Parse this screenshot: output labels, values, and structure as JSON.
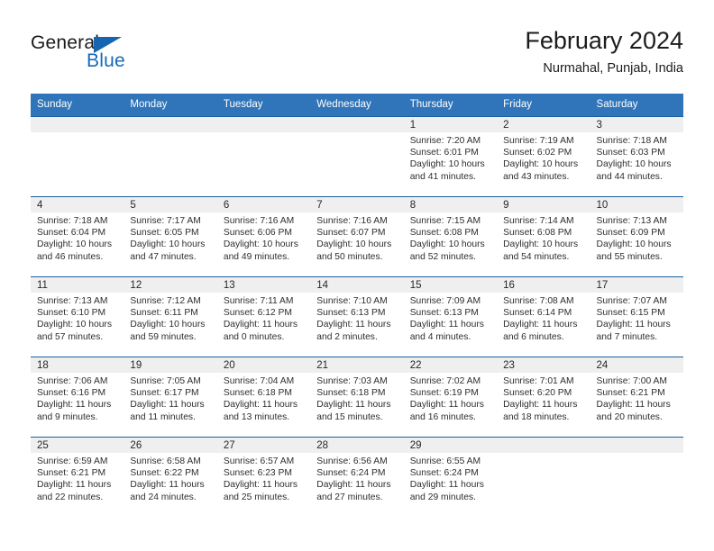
{
  "logo": {
    "word_one": "General",
    "word_two": "Blue",
    "accent_color": "#1668ba",
    "triangle_icon": "triangle-icon"
  },
  "header": {
    "title": "February 2024",
    "location": "Nurmahal, Punjab, India"
  },
  "calendar": {
    "header_bg": "#3075b9",
    "row_border": "#1b5ea0",
    "daynum_band_bg": "#efefef",
    "weekdays": [
      "Sunday",
      "Monday",
      "Tuesday",
      "Wednesday",
      "Thursday",
      "Friday",
      "Saturday"
    ],
    "weeks": [
      [
        {
          "day": "",
          "sunrise": "",
          "sunset": "",
          "daylight_line1": "",
          "daylight_line2": "",
          "empty": true
        },
        {
          "day": "",
          "sunrise": "",
          "sunset": "",
          "daylight_line1": "",
          "daylight_line2": "",
          "empty": true
        },
        {
          "day": "",
          "sunrise": "",
          "sunset": "",
          "daylight_line1": "",
          "daylight_line2": "",
          "empty": true
        },
        {
          "day": "",
          "sunrise": "",
          "sunset": "",
          "daylight_line1": "",
          "daylight_line2": "",
          "empty": true
        },
        {
          "day": "1",
          "sunrise": "Sunrise: 7:20 AM",
          "sunset": "Sunset: 6:01 PM",
          "daylight_line1": "Daylight: 10 hours",
          "daylight_line2": "and 41 minutes.",
          "empty": false
        },
        {
          "day": "2",
          "sunrise": "Sunrise: 7:19 AM",
          "sunset": "Sunset: 6:02 PM",
          "daylight_line1": "Daylight: 10 hours",
          "daylight_line2": "and 43 minutes.",
          "empty": false
        },
        {
          "day": "3",
          "sunrise": "Sunrise: 7:18 AM",
          "sunset": "Sunset: 6:03 PM",
          "daylight_line1": "Daylight: 10 hours",
          "daylight_line2": "and 44 minutes.",
          "empty": false
        }
      ],
      [
        {
          "day": "4",
          "sunrise": "Sunrise: 7:18 AM",
          "sunset": "Sunset: 6:04 PM",
          "daylight_line1": "Daylight: 10 hours",
          "daylight_line2": "and 46 minutes.",
          "empty": false
        },
        {
          "day": "5",
          "sunrise": "Sunrise: 7:17 AM",
          "sunset": "Sunset: 6:05 PM",
          "daylight_line1": "Daylight: 10 hours",
          "daylight_line2": "and 47 minutes.",
          "empty": false
        },
        {
          "day": "6",
          "sunrise": "Sunrise: 7:16 AM",
          "sunset": "Sunset: 6:06 PM",
          "daylight_line1": "Daylight: 10 hours",
          "daylight_line2": "and 49 minutes.",
          "empty": false
        },
        {
          "day": "7",
          "sunrise": "Sunrise: 7:16 AM",
          "sunset": "Sunset: 6:07 PM",
          "daylight_line1": "Daylight: 10 hours",
          "daylight_line2": "and 50 minutes.",
          "empty": false
        },
        {
          "day": "8",
          "sunrise": "Sunrise: 7:15 AM",
          "sunset": "Sunset: 6:08 PM",
          "daylight_line1": "Daylight: 10 hours",
          "daylight_line2": "and 52 minutes.",
          "empty": false
        },
        {
          "day": "9",
          "sunrise": "Sunrise: 7:14 AM",
          "sunset": "Sunset: 6:08 PM",
          "daylight_line1": "Daylight: 10 hours",
          "daylight_line2": "and 54 minutes.",
          "empty": false
        },
        {
          "day": "10",
          "sunrise": "Sunrise: 7:13 AM",
          "sunset": "Sunset: 6:09 PM",
          "daylight_line1": "Daylight: 10 hours",
          "daylight_line2": "and 55 minutes.",
          "empty": false
        }
      ],
      [
        {
          "day": "11",
          "sunrise": "Sunrise: 7:13 AM",
          "sunset": "Sunset: 6:10 PM",
          "daylight_line1": "Daylight: 10 hours",
          "daylight_line2": "and 57 minutes.",
          "empty": false
        },
        {
          "day": "12",
          "sunrise": "Sunrise: 7:12 AM",
          "sunset": "Sunset: 6:11 PM",
          "daylight_line1": "Daylight: 10 hours",
          "daylight_line2": "and 59 minutes.",
          "empty": false
        },
        {
          "day": "13",
          "sunrise": "Sunrise: 7:11 AM",
          "sunset": "Sunset: 6:12 PM",
          "daylight_line1": "Daylight: 11 hours",
          "daylight_line2": "and 0 minutes.",
          "empty": false
        },
        {
          "day": "14",
          "sunrise": "Sunrise: 7:10 AM",
          "sunset": "Sunset: 6:13 PM",
          "daylight_line1": "Daylight: 11 hours",
          "daylight_line2": "and 2 minutes.",
          "empty": false
        },
        {
          "day": "15",
          "sunrise": "Sunrise: 7:09 AM",
          "sunset": "Sunset: 6:13 PM",
          "daylight_line1": "Daylight: 11 hours",
          "daylight_line2": "and 4 minutes.",
          "empty": false
        },
        {
          "day": "16",
          "sunrise": "Sunrise: 7:08 AM",
          "sunset": "Sunset: 6:14 PM",
          "daylight_line1": "Daylight: 11 hours",
          "daylight_line2": "and 6 minutes.",
          "empty": false
        },
        {
          "day": "17",
          "sunrise": "Sunrise: 7:07 AM",
          "sunset": "Sunset: 6:15 PM",
          "daylight_line1": "Daylight: 11 hours",
          "daylight_line2": "and 7 minutes.",
          "empty": false
        }
      ],
      [
        {
          "day": "18",
          "sunrise": "Sunrise: 7:06 AM",
          "sunset": "Sunset: 6:16 PM",
          "daylight_line1": "Daylight: 11 hours",
          "daylight_line2": "and 9 minutes.",
          "empty": false
        },
        {
          "day": "19",
          "sunrise": "Sunrise: 7:05 AM",
          "sunset": "Sunset: 6:17 PM",
          "daylight_line1": "Daylight: 11 hours",
          "daylight_line2": "and 11 minutes.",
          "empty": false
        },
        {
          "day": "20",
          "sunrise": "Sunrise: 7:04 AM",
          "sunset": "Sunset: 6:18 PM",
          "daylight_line1": "Daylight: 11 hours",
          "daylight_line2": "and 13 minutes.",
          "empty": false
        },
        {
          "day": "21",
          "sunrise": "Sunrise: 7:03 AM",
          "sunset": "Sunset: 6:18 PM",
          "daylight_line1": "Daylight: 11 hours",
          "daylight_line2": "and 15 minutes.",
          "empty": false
        },
        {
          "day": "22",
          "sunrise": "Sunrise: 7:02 AM",
          "sunset": "Sunset: 6:19 PM",
          "daylight_line1": "Daylight: 11 hours",
          "daylight_line2": "and 16 minutes.",
          "empty": false
        },
        {
          "day": "23",
          "sunrise": "Sunrise: 7:01 AM",
          "sunset": "Sunset: 6:20 PM",
          "daylight_line1": "Daylight: 11 hours",
          "daylight_line2": "and 18 minutes.",
          "empty": false
        },
        {
          "day": "24",
          "sunrise": "Sunrise: 7:00 AM",
          "sunset": "Sunset: 6:21 PM",
          "daylight_line1": "Daylight: 11 hours",
          "daylight_line2": "and 20 minutes.",
          "empty": false
        }
      ],
      [
        {
          "day": "25",
          "sunrise": "Sunrise: 6:59 AM",
          "sunset": "Sunset: 6:21 PM",
          "daylight_line1": "Daylight: 11 hours",
          "daylight_line2": "and 22 minutes.",
          "empty": false
        },
        {
          "day": "26",
          "sunrise": "Sunrise: 6:58 AM",
          "sunset": "Sunset: 6:22 PM",
          "daylight_line1": "Daylight: 11 hours",
          "daylight_line2": "and 24 minutes.",
          "empty": false
        },
        {
          "day": "27",
          "sunrise": "Sunrise: 6:57 AM",
          "sunset": "Sunset: 6:23 PM",
          "daylight_line1": "Daylight: 11 hours",
          "daylight_line2": "and 25 minutes.",
          "empty": false
        },
        {
          "day": "28",
          "sunrise": "Sunrise: 6:56 AM",
          "sunset": "Sunset: 6:24 PM",
          "daylight_line1": "Daylight: 11 hours",
          "daylight_line2": "and 27 minutes.",
          "empty": false
        },
        {
          "day": "29",
          "sunrise": "Sunrise: 6:55 AM",
          "sunset": "Sunset: 6:24 PM",
          "daylight_line1": "Daylight: 11 hours",
          "daylight_line2": "and 29 minutes.",
          "empty": false
        },
        {
          "day": "",
          "sunrise": "",
          "sunset": "",
          "daylight_line1": "",
          "daylight_line2": "",
          "empty": true
        },
        {
          "day": "",
          "sunrise": "",
          "sunset": "",
          "daylight_line1": "",
          "daylight_line2": "",
          "empty": true
        }
      ]
    ]
  }
}
